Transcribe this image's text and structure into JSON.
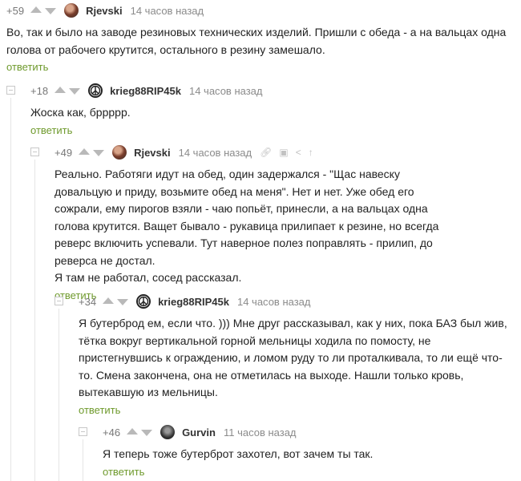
{
  "comments": [
    {
      "rating": "+59",
      "username": "Rjevski",
      "time": "14 часов назад",
      "avatar": "photo",
      "text": "Во, так и было на заводе резиновых технических изделий. Пришли с обеда - а на вальцах одна голова от рабочего крутится, остального в резину замешало.",
      "reply": "ответить"
    },
    {
      "rating": "+18",
      "username": "krieg88RIP45k",
      "time": "14 часов назад",
      "avatar": "peace",
      "text": "Жоска как, бррррр.",
      "reply": "ответить"
    },
    {
      "rating": "+49",
      "username": "Rjevski",
      "time": "14 часов назад",
      "avatar": "photo",
      "text": "Реально. Работяги идут на обед, один задержался - \"Щас навеску довальцую и приду, возьмите обед на меня\". Нет и нет. Уже обед его сожрали, ему пирогов взяли - чаю попьёт, принесли, а на вальцах одна голова крутится. Ващет бывало - рукавица прилипает к резине, но всегда реверс включить успевали. Тут наверное полез поправлять - прилип, до реверса не достал.",
      "text2": "Я там не работал, сосед рассказал.",
      "reply": "ответить",
      "tools": [
        "link-icon",
        "save-icon",
        "share-icon",
        "up-arrow-icon"
      ]
    },
    {
      "rating": "+34",
      "username": "krieg88RIP45k",
      "time": "14 часов назад",
      "avatar": "peace",
      "text": "Я бутерброд ем, если что. ))) Мне друг рассказывал, как у них, пока БАЗ был жив, тётка вокруг вертикальной горной мельницы ходила по помосту, не пристегнувшись к ограждению, и ломом руду то ли проталкивала, то ли ещё что-то. Смена закончена, она не отметилась на выходе. Нашли только кровь, вытекавшую из мельницы.",
      "reply": "ответить"
    },
    {
      "rating": "+46",
      "username": "Gurvin",
      "time": "11 часов назад",
      "avatar": "gurvin",
      "text": "Я теперь тоже бутерброт захотел, вот зачем ты так.",
      "reply": "ответить"
    }
  ]
}
